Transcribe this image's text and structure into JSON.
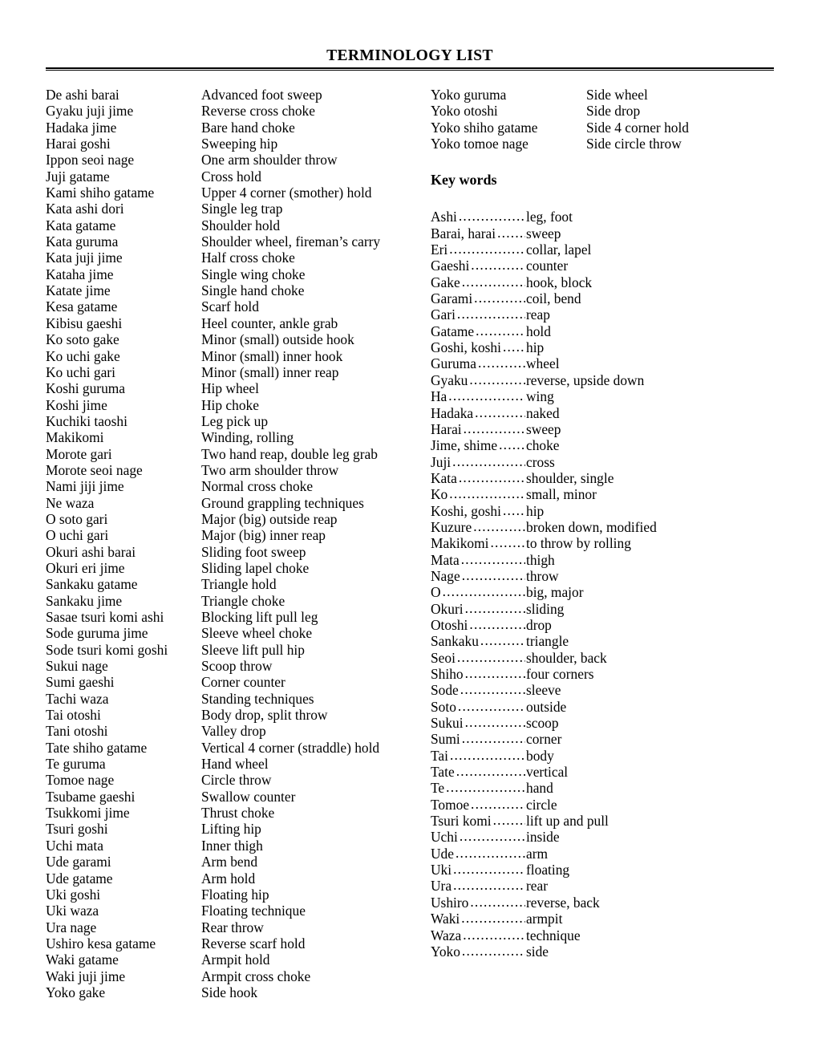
{
  "document": {
    "title": "TERMINOLOGY LIST"
  },
  "left_column": {
    "terms": [
      {
        "term": "De ashi barai",
        "meaning": "Advanced foot sweep"
      },
      {
        "term": "Gyaku juji jime",
        "meaning": "Reverse cross choke"
      },
      {
        "term": "Hadaka jime",
        "meaning": "Bare hand choke"
      },
      {
        "term": "Harai goshi",
        "meaning": "Sweeping hip"
      },
      {
        "term": "Ippon seoi nage",
        "meaning": "One arm shoulder throw"
      },
      {
        "term": "Juji gatame",
        "meaning": "Cross hold"
      },
      {
        "term": "Kami shiho gatame",
        "meaning": "Upper 4 corner (smother) hold"
      },
      {
        "term": "Kata ashi dori",
        "meaning": "Single leg trap"
      },
      {
        "term": "Kata gatame",
        "meaning": "Shoulder hold"
      },
      {
        "term": "Kata guruma",
        "meaning": "Shoulder wheel, fireman’s carry"
      },
      {
        "term": "Kata juji jime",
        "meaning": "Half cross choke"
      },
      {
        "term": "Kataha jime",
        "meaning": "Single wing choke"
      },
      {
        "term": "Katate jime",
        "meaning": "Single hand choke"
      },
      {
        "term": "Kesa gatame",
        "meaning": "Scarf hold"
      },
      {
        "term": "Kibisu gaeshi",
        "meaning": "Heel counter, ankle grab"
      },
      {
        "term": "Ko soto gake",
        "meaning": "Minor (small) outside hook"
      },
      {
        "term": "Ko uchi gake",
        "meaning": "Minor (small) inner hook"
      },
      {
        "term": "Ko uchi gari",
        "meaning": "Minor (small) inner reap"
      },
      {
        "term": "Koshi guruma",
        "meaning": "Hip wheel"
      },
      {
        "term": "Koshi jime",
        "meaning": "Hip choke"
      },
      {
        "term": "Kuchiki taoshi",
        "meaning": "Leg pick up"
      },
      {
        "term": "Makikomi",
        "meaning": "Winding, rolling"
      },
      {
        "term": "Morote gari",
        "meaning": "Two hand reap, double leg grab"
      },
      {
        "term": "Morote seoi nage",
        "meaning": "Two arm shoulder throw"
      },
      {
        "term": "Nami jiji jime",
        "meaning": "Normal cross choke"
      },
      {
        "term": "Ne waza",
        "meaning": "Ground grappling techniques"
      },
      {
        "term": "O soto gari",
        "meaning": "Major (big) outside reap"
      },
      {
        "term": "O uchi gari",
        "meaning": "Major (big) inner reap"
      },
      {
        "term": "Okuri ashi barai",
        "meaning": "Sliding foot sweep"
      },
      {
        "term": "Okuri eri jime",
        "meaning": "Sliding lapel choke"
      },
      {
        "term": "Sankaku gatame",
        "meaning": "Triangle hold"
      },
      {
        "term": "Sankaku jime",
        "meaning": "Triangle choke"
      },
      {
        "term": "Sasae tsuri komi ashi",
        "meaning": "Blocking lift pull leg"
      },
      {
        "term": "Sode guruma jime",
        "meaning": "Sleeve wheel choke"
      },
      {
        "term": "Sode tsuri komi goshi",
        "meaning": "Sleeve lift pull hip"
      },
      {
        "term": "Sukui nage",
        "meaning": "Scoop throw"
      },
      {
        "term": "Sumi gaeshi",
        "meaning": "Corner counter"
      },
      {
        "term": "Tachi waza",
        "meaning": "Standing techniques"
      },
      {
        "term": "Tai otoshi",
        "meaning": "Body drop, split throw"
      },
      {
        "term": "Tani otoshi",
        "meaning": "Valley drop"
      },
      {
        "term": "Tate shiho gatame",
        "meaning": "Vertical 4 corner (straddle) hold"
      },
      {
        "term": "Te guruma",
        "meaning": "Hand wheel"
      },
      {
        "term": "Tomoe nage",
        "meaning": "Circle throw"
      },
      {
        "term": "Tsubame gaeshi",
        "meaning": "Swallow counter"
      },
      {
        "term": "Tsukkomi jime",
        "meaning": "Thrust choke"
      },
      {
        "term": "Tsuri goshi",
        "meaning": "Lifting hip"
      },
      {
        "term": "Uchi mata",
        "meaning": "Inner thigh"
      },
      {
        "term": "Ude garami",
        "meaning": "Arm bend"
      },
      {
        "term": "Ude gatame",
        "meaning": "Arm hold"
      },
      {
        "term": "Uki goshi",
        "meaning": "Floating hip"
      },
      {
        "term": "Uki waza",
        "meaning": "Floating technique"
      },
      {
        "term": "Ura nage",
        "meaning": "Rear throw"
      },
      {
        "term": "Ushiro kesa gatame",
        "meaning": "Reverse scarf hold"
      },
      {
        "term": "Waki gatame",
        "meaning": "Armpit hold"
      },
      {
        "term": "Waki juji jime",
        "meaning": "Armpit cross choke"
      },
      {
        "term": "Yoko gake",
        "meaning": "Side hook"
      }
    ]
  },
  "right_column": {
    "terms": [
      {
        "term": "Yoko guruma",
        "meaning": "Side wheel"
      },
      {
        "term": "Yoko otoshi",
        "meaning": "Side drop"
      },
      {
        "term": "Yoko shiho gatame",
        "meaning": "Side 4 corner hold"
      },
      {
        "term": "Yoko tomoe nage",
        "meaning": "Side circle throw"
      }
    ],
    "keywords": {
      "heading": "Key words",
      "entries": [
        {
          "term": "Ashi",
          "meaning": "leg, foot"
        },
        {
          "term": "Barai, harai",
          "meaning": "sweep"
        },
        {
          "term": "Eri",
          "meaning": "collar, lapel"
        },
        {
          "term": "Gaeshi",
          "meaning": "counter"
        },
        {
          "term": "Gake",
          "meaning": "hook, block"
        },
        {
          "term": "Garami",
          "meaning": "coil, bend"
        },
        {
          "term": "Gari",
          "meaning": "reap"
        },
        {
          "term": "Gatame",
          "meaning": "hold"
        },
        {
          "term": "Goshi, koshi",
          "meaning": "hip"
        },
        {
          "term": "Guruma",
          "meaning": "wheel"
        },
        {
          "term": "Gyaku",
          "meaning": "reverse, upside down"
        },
        {
          "term": "Ha",
          "meaning": "wing"
        },
        {
          "term": "Hadaka",
          "meaning": "naked"
        },
        {
          "term": "Harai",
          "meaning": "sweep"
        },
        {
          "term": "Jime, shime",
          "meaning": "choke"
        },
        {
          "term": "Juji",
          "meaning": "cross"
        },
        {
          "term": "Kata",
          "meaning": "shoulder, single"
        },
        {
          "term": "Ko",
          "meaning": "small, minor"
        },
        {
          "term": "Koshi, goshi",
          "meaning": "hip"
        },
        {
          "term": "Kuzure",
          "meaning": "broken down, modified"
        },
        {
          "term": "Makikomi",
          "meaning": "to throw by rolling"
        },
        {
          "term": "Mata",
          "meaning": "thigh"
        },
        {
          "term": "Nage",
          "meaning": "throw"
        },
        {
          "term": "O",
          "meaning": "big, major"
        },
        {
          "term": "Okuri",
          "meaning": "sliding"
        },
        {
          "term": "Otoshi",
          "meaning": "drop"
        },
        {
          "term": "Sankaku",
          "meaning": "triangle"
        },
        {
          "term": "Seoi",
          "meaning": "shoulder, back"
        },
        {
          "term": "Shiho",
          "meaning": "four corners"
        },
        {
          "term": "Sode",
          "meaning": "sleeve"
        },
        {
          "term": "Soto",
          "meaning": "outside"
        },
        {
          "term": "Sukui",
          "meaning": "scoop"
        },
        {
          "term": "Sumi",
          "meaning": "corner"
        },
        {
          "term": "Tai",
          "meaning": "body"
        },
        {
          "term": "Tate",
          "meaning": "vertical"
        },
        {
          "term": "Te",
          "meaning": "hand"
        },
        {
          "term": "Tomoe",
          "meaning": "circle"
        },
        {
          "term": "Tsuri komi",
          "meaning": "lift up and pull"
        },
        {
          "term": "Uchi",
          "meaning": "inside"
        },
        {
          "term": "Ude",
          "meaning": "arm"
        },
        {
          "term": "Uki",
          "meaning": "floating"
        },
        {
          "term": "Ura",
          "meaning": "rear"
        },
        {
          "term": "Ushiro",
          "meaning": "reverse, back"
        },
        {
          "term": "Waki",
          "meaning": "armpit"
        },
        {
          "term": "Waza",
          "meaning": "technique"
        },
        {
          "term": "Yoko",
          "meaning": "side"
        }
      ]
    }
  }
}
